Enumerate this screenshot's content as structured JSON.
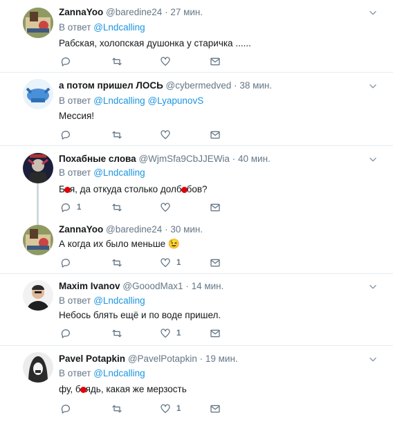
{
  "tweets": [
    {
      "name": "ZannaYoo",
      "handle": "@baredine24",
      "dot": "·",
      "time": "27 мин.",
      "reply_prefix": "В ответ",
      "reply_to": "@Lndcalling",
      "text": "Рабская, холопская душонка у старичка ......",
      "replies": "",
      "retweets": "",
      "likes": ""
    },
    {
      "name": "а потом пришел ЛОСЬ",
      "handle": "@cybermedved",
      "dot": "·",
      "time": "38 мин.",
      "reply_prefix": "В ответ",
      "reply_to": "@Lndcalling @LyapunovS",
      "text": "Мессия!",
      "replies": "",
      "retweets": "",
      "likes": ""
    },
    {
      "name": "Похабные слова",
      "handle": "@WjmSfa9CbJJEWia",
      "dot": "·",
      "time": "40 мин.",
      "reply_prefix": "В ответ",
      "reply_to": "@Lndcalling",
      "text_a": "Б",
      "text_b": "я, да откуда столько долб",
      "text_c": "бов?",
      "replies": "1",
      "retweets": "",
      "likes": ""
    },
    {
      "name": "ZannaYoo",
      "handle": "@baredine24",
      "dot": "·",
      "time": "30 мин.",
      "text": "А когда их было меньше",
      "emoji": "😉",
      "replies": "",
      "retweets": "",
      "likes": "1"
    },
    {
      "name": "Maxim Ivanov",
      "handle": "@GooodMax1",
      "dot": "·",
      "time": "14 мин.",
      "reply_prefix": "В ответ",
      "reply_to": "@Lndcalling",
      "text": "Небось блять ещё и по воде пришел.",
      "replies": "",
      "retweets": "",
      "likes": "1"
    },
    {
      "name": "Pavel Potapkin",
      "handle": "@PavelPotapkin",
      "dot": "·",
      "time": "19 мин.",
      "reply_prefix": "В ответ",
      "reply_to": "@Lndcalling",
      "text_a": "фу, б",
      "text_b": "ядь, какая же мерзость",
      "replies": "",
      "retweets": "",
      "likes": "1"
    }
  ],
  "icons": {
    "reply": "reply-icon",
    "retweet": "retweet-icon",
    "like": "heart-icon",
    "dm": "envelope-icon",
    "menu": "chevron-down-icon"
  },
  "colors": {
    "link": "#1b95e0",
    "muted": "#657786",
    "thread": "#cfd9de",
    "redaction": "#e0000a"
  }
}
